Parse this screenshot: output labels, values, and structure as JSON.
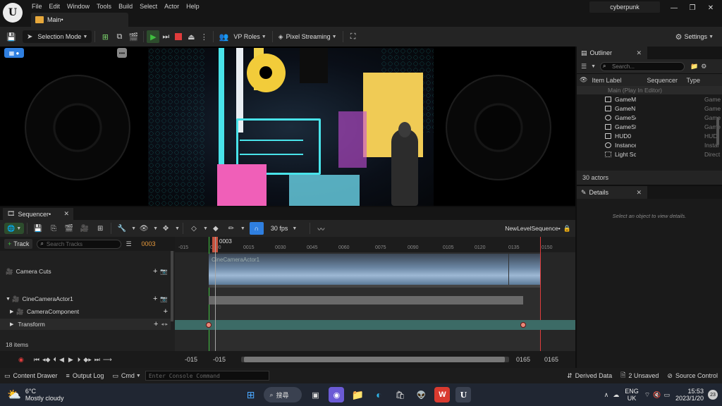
{
  "menu": [
    "File",
    "Edit",
    "Window",
    "Tools",
    "Build",
    "Select",
    "Actor",
    "Help"
  ],
  "main_tab": "Main•",
  "project_name": "cyberpunk",
  "toolbar": {
    "selection_mode": "Selection Mode",
    "vp_roles": "VP Roles",
    "pixel_streaming": "Pixel Streaming",
    "settings": "Settings"
  },
  "outliner": {
    "title": "Outliner",
    "search_placeholder": "Search...",
    "col_label": "Item Label",
    "col_sequencer": "Sequencer",
    "col_type": "Type",
    "root": "Main (Play In Editor)",
    "items": [
      {
        "name": "GameM",
        "type": "Game"
      },
      {
        "name": "GameN",
        "type": "Game"
      },
      {
        "name": "GameSe",
        "type": "Game"
      },
      {
        "name": "GameSt",
        "type": "Game"
      },
      {
        "name": "HUD0",
        "type": "HUD"
      },
      {
        "name": "Instance",
        "type": "Instar"
      },
      {
        "name": "Light Sc",
        "type": "Direct"
      }
    ],
    "actor_count": "30 actors"
  },
  "details": {
    "title": "Details",
    "empty_text": "Select an object to view details."
  },
  "sequencer": {
    "tab": "Sequencer•",
    "fps": "30 fps",
    "sequence_name": "NewLevelSequence•",
    "add_track": "Track",
    "search_placeholder": "Search Tracks",
    "current_frame": "0003",
    "playhead_label": "0003",
    "tracks": [
      "Camera Cuts",
      "CineCameraActor1",
      "CameraComponent",
      "Transform"
    ],
    "clip_label": "CineCameraActor1",
    "item_count": "18 items",
    "ruler": [
      "-015",
      "0000",
      "0015",
      "0030",
      "0045",
      "0060",
      "0075",
      "0090",
      "0105",
      "0120",
      "0135",
      "0150"
    ],
    "range_start": "-015",
    "range_start2": "-015",
    "range_end": "0165",
    "range_end2": "0165"
  },
  "statusbar": {
    "content_drawer": "Content Drawer",
    "output_log": "Output Log",
    "cmd": "Cmd",
    "console_placeholder": "Enter Console Command",
    "derived_data": "Derived Data",
    "unsaved": "2 Unsaved",
    "source_control": "Source Control"
  },
  "taskbar": {
    "temp": "6°C",
    "weather": "Mostly cloudy",
    "search": "搜尋",
    "lang1": "ENG",
    "lang2": "UK",
    "time": "15:53",
    "date": "2023/1/20",
    "notif": "23"
  },
  "colors": {
    "accent": "#2f7fe0",
    "play_green": "#3fbf3f",
    "stop_red": "#e03c3c",
    "key_salmon": "#e88a7a"
  }
}
